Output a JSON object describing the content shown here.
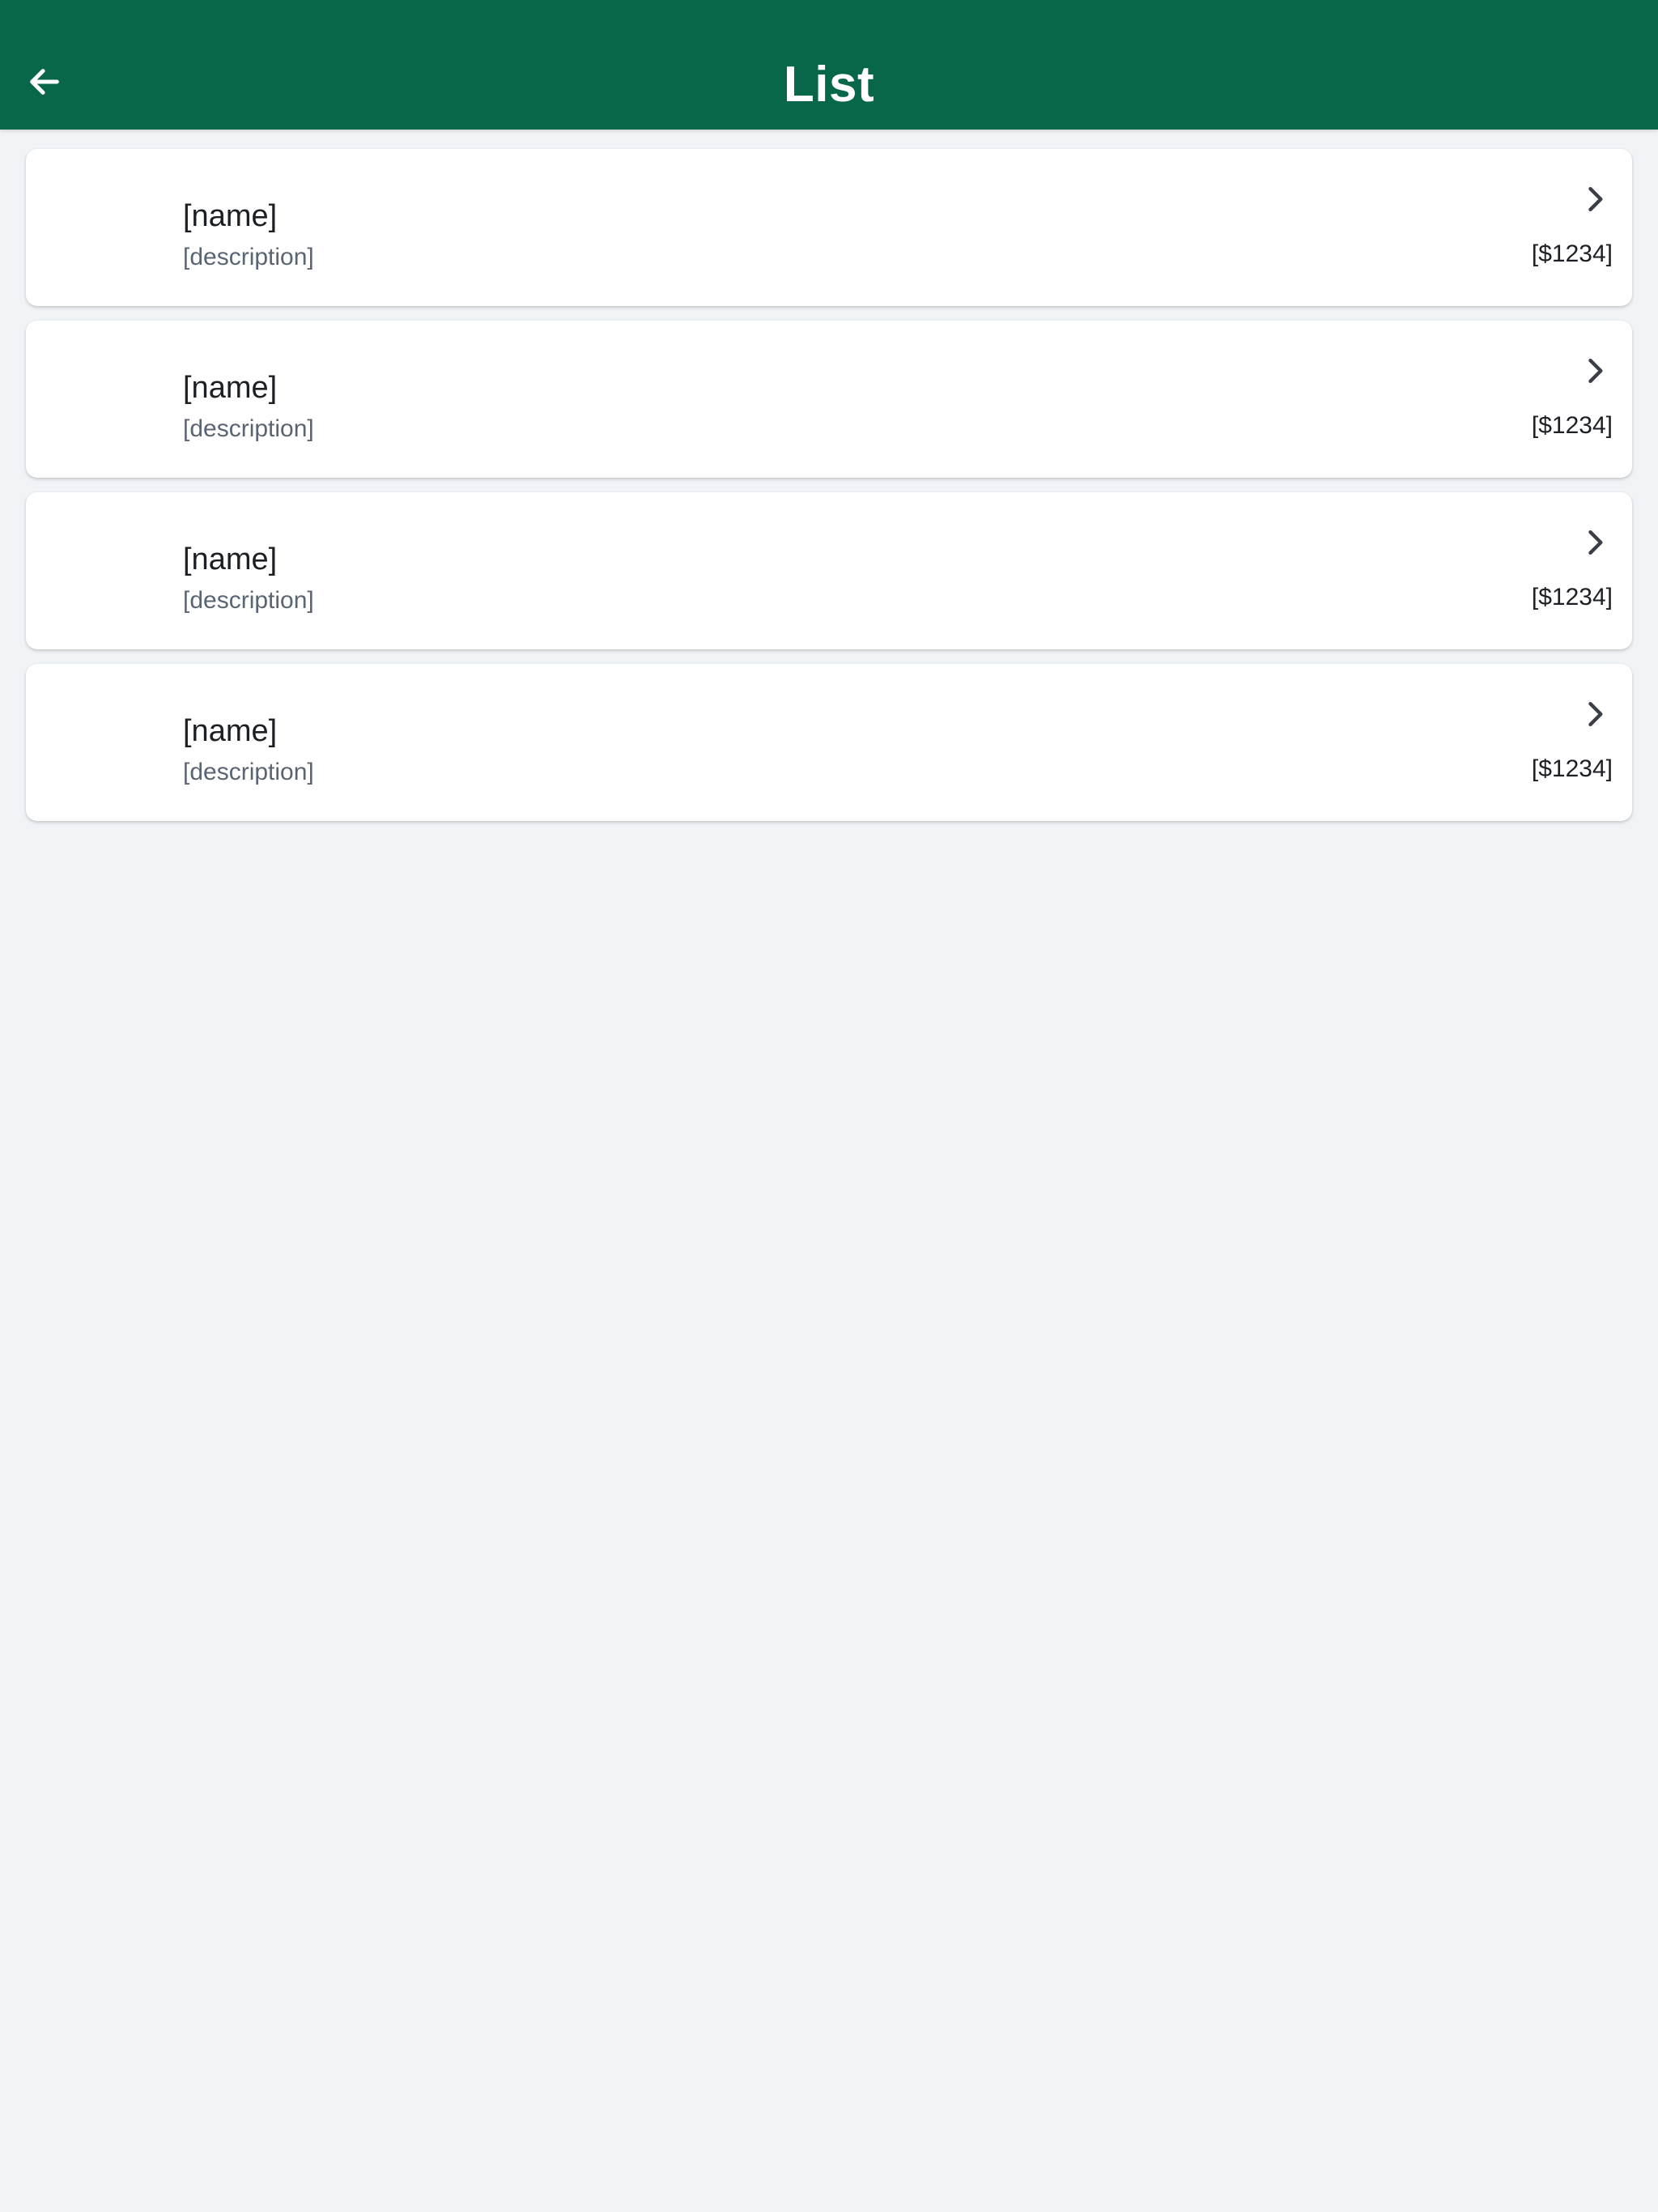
{
  "app_bar": {
    "title": "List",
    "back_icon": "arrow-left-icon",
    "background_color": "#08664b",
    "text_color": "#ffffff"
  },
  "page": {
    "background_color": "#f0f4f7"
  },
  "items": [
    {
      "name": "[name]",
      "description": "[description]",
      "price": "[$1234]",
      "trailing_icon": "chevron-right-icon"
    },
    {
      "name": "[name]",
      "description": "[description]",
      "price": "[$1234]",
      "trailing_icon": "chevron-right-icon"
    },
    {
      "name": "[name]",
      "description": "[description]",
      "price": "[$1234]",
      "trailing_icon": "chevron-right-icon"
    },
    {
      "name": "[name]",
      "description": "[description]",
      "price": "[$1234]",
      "trailing_icon": "chevron-right-icon"
    }
  ]
}
